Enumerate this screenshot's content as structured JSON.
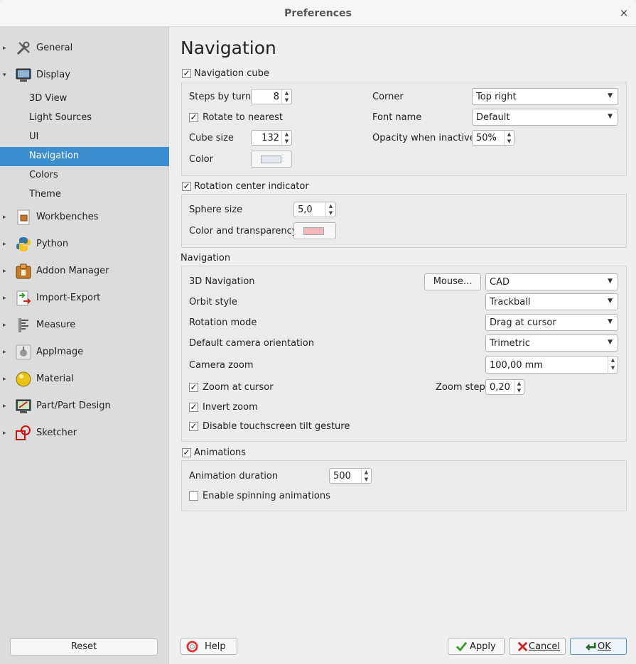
{
  "window": {
    "title": "Preferences",
    "close_glyph": "×"
  },
  "sidebar": {
    "items": [
      {
        "label": "General",
        "icon": "tools-icon"
      },
      {
        "label": "Display",
        "icon": "monitor-icon",
        "expanded": true
      },
      {
        "label": "3D View"
      },
      {
        "label": "Light Sources"
      },
      {
        "label": "UI"
      },
      {
        "label": "Navigation",
        "selected": true
      },
      {
        "label": "Colors"
      },
      {
        "label": "Theme"
      },
      {
        "label": "Workbenches",
        "icon": "workbench-icon"
      },
      {
        "label": "Python",
        "icon": "python-icon"
      },
      {
        "label": "Addon Manager",
        "icon": "addon-icon"
      },
      {
        "label": "Import-Export",
        "icon": "import-export-icon"
      },
      {
        "label": "Measure",
        "icon": "measure-icon"
      },
      {
        "label": "AppImage",
        "icon": "appimage-icon"
      },
      {
        "label": "Material",
        "icon": "material-icon"
      },
      {
        "label": "Part/Part Design",
        "icon": "part-design-icon"
      },
      {
        "label": "Sketcher",
        "icon": "sketcher-icon"
      }
    ],
    "reset_label": "Reset"
  },
  "page": {
    "heading": "Navigation"
  },
  "nav_cube": {
    "checkbox_label": "Navigation cube",
    "checked": true,
    "steps_label": "Steps by turn",
    "steps_value": "8",
    "rotate_label": "Rotate to nearest",
    "rotate_checked": true,
    "cube_size_label": "Cube size",
    "cube_size_value": "132",
    "color_label": "Color",
    "color_value": "#e4e8ee",
    "corner_label": "Corner",
    "corner_value": "Top right",
    "font_label": "Font name",
    "font_value": "Default",
    "opacity_label": "Opacity when inactive",
    "opacity_value": "50%"
  },
  "rotation_center": {
    "checkbox_label": "Rotation center indicator",
    "checked": true,
    "sphere_label": "Sphere size",
    "sphere_value": "5,0",
    "color_label": "Color and transparency",
    "color_value": "#f4b8bc"
  },
  "navigation": {
    "group_label": "Navigation",
    "nav3d_label": "3D Navigation",
    "mouse_button": "Mouse...",
    "nav3d_value": "CAD",
    "orbit_label": "Orbit style",
    "orbit_value": "Trackball",
    "rotation_mode_label": "Rotation mode",
    "rotation_mode_value": "Drag at cursor",
    "camera_orient_label": "Default camera orientation",
    "camera_orient_value": "Trimetric",
    "camera_zoom_label": "Camera zoom",
    "camera_zoom_value": "100,00 mm",
    "zoom_cursor_label": "Zoom at cursor",
    "zoom_cursor_checked": true,
    "zoom_step_label": "Zoom step",
    "zoom_step_value": "0,20",
    "invert_zoom_label": "Invert zoom",
    "invert_zoom_checked": true,
    "disable_tilt_label": "Disable touchscreen tilt gesture",
    "disable_tilt_checked": true
  },
  "animations": {
    "checkbox_label": "Animations",
    "checked": true,
    "duration_label": "Animation duration",
    "duration_value": "500",
    "spinning_label": "Enable spinning animations",
    "spinning_checked": false
  },
  "footer": {
    "help_label": "Help",
    "apply_label": "Apply",
    "cancel_label": "Cancel",
    "ok_label": "OK"
  },
  "glyphs": {
    "check": "✓",
    "arrow_right": "▸",
    "arrow_down": "▾",
    "combo": "▼",
    "spin": "▲\n▼"
  }
}
